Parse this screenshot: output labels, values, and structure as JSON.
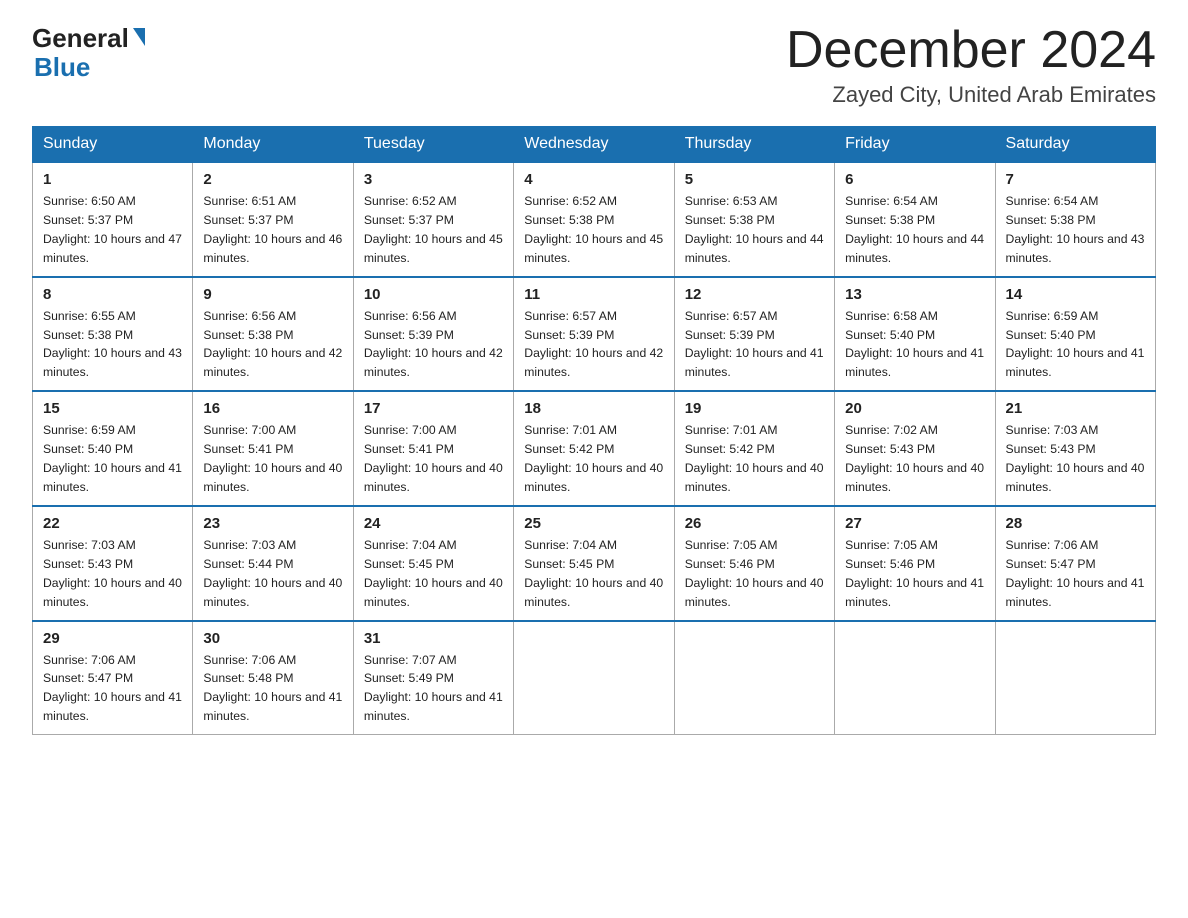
{
  "logo": {
    "general": "General",
    "blue": "Blue"
  },
  "header": {
    "month_year": "December 2024",
    "location": "Zayed City, United Arab Emirates"
  },
  "days_of_week": [
    "Sunday",
    "Monday",
    "Tuesday",
    "Wednesday",
    "Thursday",
    "Friday",
    "Saturday"
  ],
  "weeks": [
    [
      {
        "day": "1",
        "sunrise": "6:50 AM",
        "sunset": "5:37 PM",
        "daylight": "10 hours and 47 minutes."
      },
      {
        "day": "2",
        "sunrise": "6:51 AM",
        "sunset": "5:37 PM",
        "daylight": "10 hours and 46 minutes."
      },
      {
        "day": "3",
        "sunrise": "6:52 AM",
        "sunset": "5:37 PM",
        "daylight": "10 hours and 45 minutes."
      },
      {
        "day": "4",
        "sunrise": "6:52 AM",
        "sunset": "5:38 PM",
        "daylight": "10 hours and 45 minutes."
      },
      {
        "day": "5",
        "sunrise": "6:53 AM",
        "sunset": "5:38 PM",
        "daylight": "10 hours and 44 minutes."
      },
      {
        "day": "6",
        "sunrise": "6:54 AM",
        "sunset": "5:38 PM",
        "daylight": "10 hours and 44 minutes."
      },
      {
        "day": "7",
        "sunrise": "6:54 AM",
        "sunset": "5:38 PM",
        "daylight": "10 hours and 43 minutes."
      }
    ],
    [
      {
        "day": "8",
        "sunrise": "6:55 AM",
        "sunset": "5:38 PM",
        "daylight": "10 hours and 43 minutes."
      },
      {
        "day": "9",
        "sunrise": "6:56 AM",
        "sunset": "5:38 PM",
        "daylight": "10 hours and 42 minutes."
      },
      {
        "day": "10",
        "sunrise": "6:56 AM",
        "sunset": "5:39 PM",
        "daylight": "10 hours and 42 minutes."
      },
      {
        "day": "11",
        "sunrise": "6:57 AM",
        "sunset": "5:39 PM",
        "daylight": "10 hours and 42 minutes."
      },
      {
        "day": "12",
        "sunrise": "6:57 AM",
        "sunset": "5:39 PM",
        "daylight": "10 hours and 41 minutes."
      },
      {
        "day": "13",
        "sunrise": "6:58 AM",
        "sunset": "5:40 PM",
        "daylight": "10 hours and 41 minutes."
      },
      {
        "day": "14",
        "sunrise": "6:59 AM",
        "sunset": "5:40 PM",
        "daylight": "10 hours and 41 minutes."
      }
    ],
    [
      {
        "day": "15",
        "sunrise": "6:59 AM",
        "sunset": "5:40 PM",
        "daylight": "10 hours and 41 minutes."
      },
      {
        "day": "16",
        "sunrise": "7:00 AM",
        "sunset": "5:41 PM",
        "daylight": "10 hours and 40 minutes."
      },
      {
        "day": "17",
        "sunrise": "7:00 AM",
        "sunset": "5:41 PM",
        "daylight": "10 hours and 40 minutes."
      },
      {
        "day": "18",
        "sunrise": "7:01 AM",
        "sunset": "5:42 PM",
        "daylight": "10 hours and 40 minutes."
      },
      {
        "day": "19",
        "sunrise": "7:01 AM",
        "sunset": "5:42 PM",
        "daylight": "10 hours and 40 minutes."
      },
      {
        "day": "20",
        "sunrise": "7:02 AM",
        "sunset": "5:43 PM",
        "daylight": "10 hours and 40 minutes."
      },
      {
        "day": "21",
        "sunrise": "7:03 AM",
        "sunset": "5:43 PM",
        "daylight": "10 hours and 40 minutes."
      }
    ],
    [
      {
        "day": "22",
        "sunrise": "7:03 AM",
        "sunset": "5:43 PM",
        "daylight": "10 hours and 40 minutes."
      },
      {
        "day": "23",
        "sunrise": "7:03 AM",
        "sunset": "5:44 PM",
        "daylight": "10 hours and 40 minutes."
      },
      {
        "day": "24",
        "sunrise": "7:04 AM",
        "sunset": "5:45 PM",
        "daylight": "10 hours and 40 minutes."
      },
      {
        "day": "25",
        "sunrise": "7:04 AM",
        "sunset": "5:45 PM",
        "daylight": "10 hours and 40 minutes."
      },
      {
        "day": "26",
        "sunrise": "7:05 AM",
        "sunset": "5:46 PM",
        "daylight": "10 hours and 40 minutes."
      },
      {
        "day": "27",
        "sunrise": "7:05 AM",
        "sunset": "5:46 PM",
        "daylight": "10 hours and 41 minutes."
      },
      {
        "day": "28",
        "sunrise": "7:06 AM",
        "sunset": "5:47 PM",
        "daylight": "10 hours and 41 minutes."
      }
    ],
    [
      {
        "day": "29",
        "sunrise": "7:06 AM",
        "sunset": "5:47 PM",
        "daylight": "10 hours and 41 minutes."
      },
      {
        "day": "30",
        "sunrise": "7:06 AM",
        "sunset": "5:48 PM",
        "daylight": "10 hours and 41 minutes."
      },
      {
        "day": "31",
        "sunrise": "7:07 AM",
        "sunset": "5:49 PM",
        "daylight": "10 hours and 41 minutes."
      },
      null,
      null,
      null,
      null
    ]
  ],
  "labels": {
    "sunrise": "Sunrise: ",
    "sunset": "Sunset: ",
    "daylight": "Daylight: "
  }
}
